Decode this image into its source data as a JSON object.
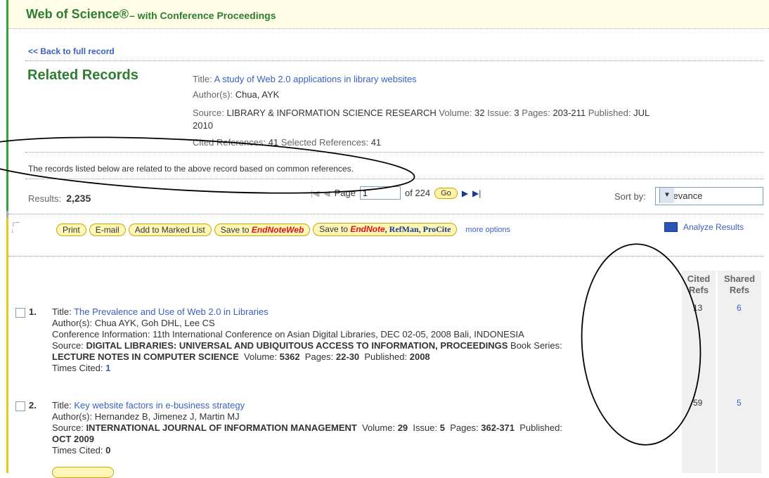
{
  "header": {
    "brand": "Web of Science®",
    "subtitle": "– with Conference Proceedings"
  },
  "back_link": "<< Back to full record",
  "related_title": "Related Records",
  "source_record": {
    "title_label": "Title:",
    "title": "A study of Web 2.0 applications in library websites",
    "authors_label": "Author(s):",
    "authors": "Chua, AYK",
    "source_label": "Source:",
    "source": "LIBRARY & INFORMATION SCIENCE RESEARCH",
    "volume_label": "Volume:",
    "volume": "32",
    "issue_label": "Issue:",
    "issue": "3",
    "pages_label": "Pages:",
    "pages": "203-211",
    "published_label": "Published:",
    "published_line1": "JUL",
    "published_line2": "2010",
    "cited_label": "Cited References:",
    "cited": "41",
    "selected_label": "Selected References:",
    "selected": "41"
  },
  "notice": "The records listed below are related to the above record based on common references.",
  "results": {
    "label": "Results:",
    "count": "2,235"
  },
  "pager": {
    "page_label": "Page",
    "page_value": "1",
    "of_label": "of 224",
    "go": "Go"
  },
  "sort": {
    "label": "Sort by:",
    "value": "Relevance"
  },
  "toolbar": {
    "print": "Print",
    "email": "E-mail",
    "marked": "Add to Marked List",
    "save_web_prefix": "Save to",
    "endnote": "EndNote",
    "web": "Web",
    "save_desktop_prefix": "Save to",
    "endnote2": "EndNote",
    "refman": ", RefMan, ProCite",
    "more": "more options",
    "analyze": "Analyze Results"
  },
  "columns": {
    "cited": "Cited Refs",
    "cited_l1": "Cited",
    "cited_l2": "Refs",
    "shared_l1": "Shared",
    "shared_l2": "Refs"
  },
  "records": [
    {
      "num": "1.",
      "title": "The Prevalence and Use of Web 2.0 in Libraries",
      "authors": "Chua AYK, Goh DHL, Lee CS",
      "conference": "11th International Conference on Asian Digital Libraries, DEC 02-05, 2008 Bali, INDONESIA",
      "source": "DIGITAL LIBRARIES: UNIVERSAL AND UBIQUITOUS ACCESS TO INFORMATION, PROCEEDINGS",
      "book_series_label": "Book Series:",
      "book_series": "LECTURE NOTES IN COMPUTER SCIENCE",
      "volume": "5362",
      "pages": "22-30",
      "published": "2008",
      "times_cited": "1",
      "cited_refs": "13",
      "shared_refs": "6"
    },
    {
      "num": "2.",
      "title": "Key website factors in e-business strategy",
      "authors": "Hernandez B, Jimenez J, Martin MJ",
      "source": "INTERNATIONAL JOURNAL OF INFORMATION MANAGEMENT",
      "volume": "29",
      "issue": "5",
      "pages": "362-371",
      "published_label": "Published:",
      "published": "OCT 2009",
      "times_cited": "0",
      "cited_refs": "59",
      "shared_refs": "5"
    }
  ],
  "labels": {
    "title": "Title:",
    "authors": "Author(s):",
    "conference": "Conference Information:",
    "source": "Source:",
    "volume": "Volume:",
    "issue": "Issue:",
    "pages": "Pages:",
    "published": "Published:",
    "times_cited": "Times Cited:"
  }
}
